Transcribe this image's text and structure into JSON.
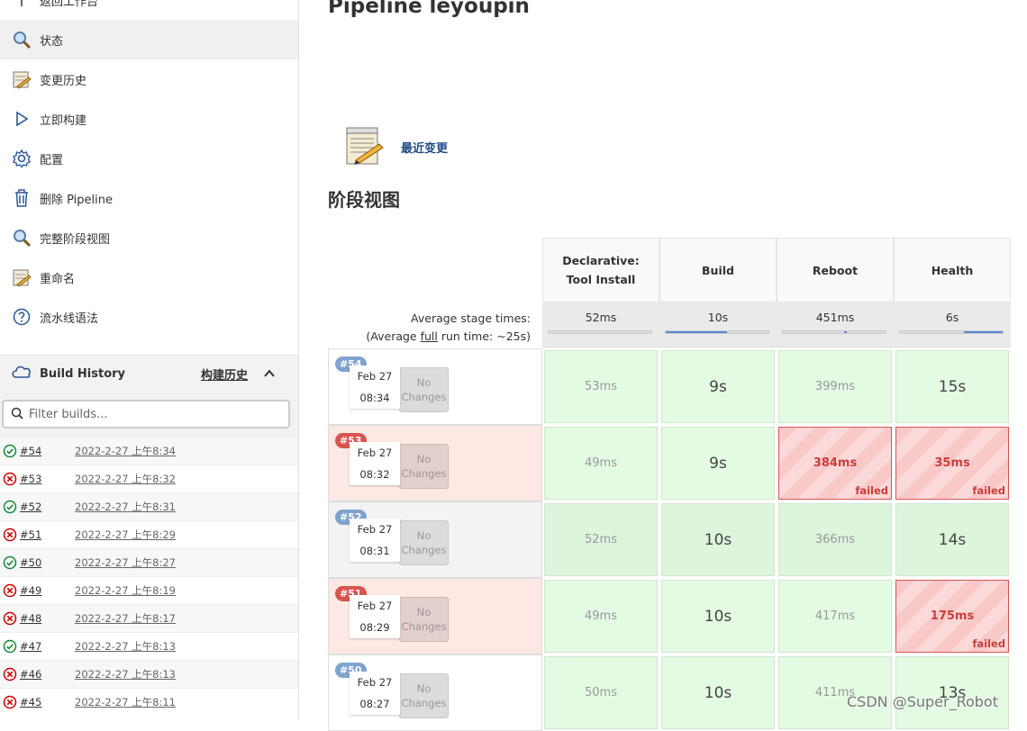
{
  "sidebar": {
    "back_label": "返回工作台",
    "items": [
      {
        "label": "状态",
        "icon": "search-icon"
      },
      {
        "label": "变更历史",
        "icon": "notepad-icon"
      },
      {
        "label": "立即构建",
        "icon": "play-icon"
      },
      {
        "label": "配置",
        "icon": "gear-icon"
      },
      {
        "label": "删除 Pipeline",
        "icon": "trash-icon"
      },
      {
        "label": "完整阶段视图",
        "icon": "search-icon"
      },
      {
        "label": "重命名",
        "icon": "notepad-icon"
      },
      {
        "label": "流水线语法",
        "icon": "help-icon"
      }
    ]
  },
  "build_history": {
    "title": "Build History",
    "cn_label": "构建历史",
    "filter_placeholder": "Filter builds...",
    "rows": [
      {
        "num": "#54",
        "date": "2022-2-27 上午8:34",
        "status": "success"
      },
      {
        "num": "#53",
        "date": "2022-2-27 上午8:32",
        "status": "failed"
      },
      {
        "num": "#52",
        "date": "2022-2-27 上午8:31",
        "status": "success"
      },
      {
        "num": "#51",
        "date": "2022-2-27 上午8:29",
        "status": "failed"
      },
      {
        "num": "#50",
        "date": "2022-2-27 上午8:27",
        "status": "success"
      },
      {
        "num": "#49",
        "date": "2022-2-27 上午8:19",
        "status": "failed"
      },
      {
        "num": "#48",
        "date": "2022-2-27 上午8:17",
        "status": "failed"
      },
      {
        "num": "#47",
        "date": "2022-2-27 上午8:13",
        "status": "success"
      },
      {
        "num": "#46",
        "date": "2022-2-27 上午8:13",
        "status": "failed"
      },
      {
        "num": "#45",
        "date": "2022-2-27 上午8:11",
        "status": "failed"
      }
    ]
  },
  "main": {
    "title": "Pipeline leyoupin",
    "recent_changes": "最近变更",
    "stage_view_title": "阶段视图"
  },
  "stage_view": {
    "avg_label_1": "Average stage times:",
    "avg_label_2_pre": "(Average ",
    "avg_label_2_link": "full",
    "avg_label_2_post": " run time: ~25s)",
    "stages": [
      {
        "name_1": "Declarative:",
        "name_2": "Tool Install",
        "avg": "52ms",
        "fill": 0.0
      },
      {
        "name_1": "Build",
        "name_2": "",
        "avg": "10s",
        "fill": 0.6
      },
      {
        "name_1": "Reboot",
        "name_2": "",
        "avg": "451ms",
        "fill": 0.6
      },
      {
        "name_1": "Health",
        "name_2": "",
        "avg": "6s",
        "fill": 0.38
      }
    ],
    "no_changes_1": "No",
    "no_changes_2": "Changes",
    "failed_label": "failed",
    "builds": [
      {
        "num": "#54",
        "date": "Feb 27",
        "time": "08:34",
        "status": "success",
        "cells": [
          {
            "v": "53ms"
          },
          {
            "v": "9s"
          },
          {
            "v": "399ms"
          },
          {
            "v": "15s"
          }
        ]
      },
      {
        "num": "#53",
        "date": "Feb 27",
        "time": "08:32",
        "status": "failed",
        "cells": [
          {
            "v": "49ms"
          },
          {
            "v": "9s"
          },
          {
            "v": "384ms",
            "fail": true
          },
          {
            "v": "35ms",
            "fail": true
          }
        ]
      },
      {
        "num": "#52",
        "date": "Feb 27",
        "time": "08:31",
        "status": "success",
        "cells": [
          {
            "v": "52ms"
          },
          {
            "v": "10s"
          },
          {
            "v": "366ms"
          },
          {
            "v": "14s"
          }
        ]
      },
      {
        "num": "#51",
        "date": "Feb 27",
        "time": "08:29",
        "status": "failed",
        "cells": [
          {
            "v": "49ms"
          },
          {
            "v": "10s"
          },
          {
            "v": "417ms"
          },
          {
            "v": "175ms",
            "fail": true
          }
        ]
      },
      {
        "num": "#50",
        "date": "Feb 27",
        "time": "08:27",
        "status": "success",
        "cells": [
          {
            "v": "50ms"
          },
          {
            "v": "10s"
          },
          {
            "v": "411ms"
          },
          {
            "v": "13s"
          }
        ]
      }
    ]
  },
  "watermark": "CSDN @Super_Robot"
}
